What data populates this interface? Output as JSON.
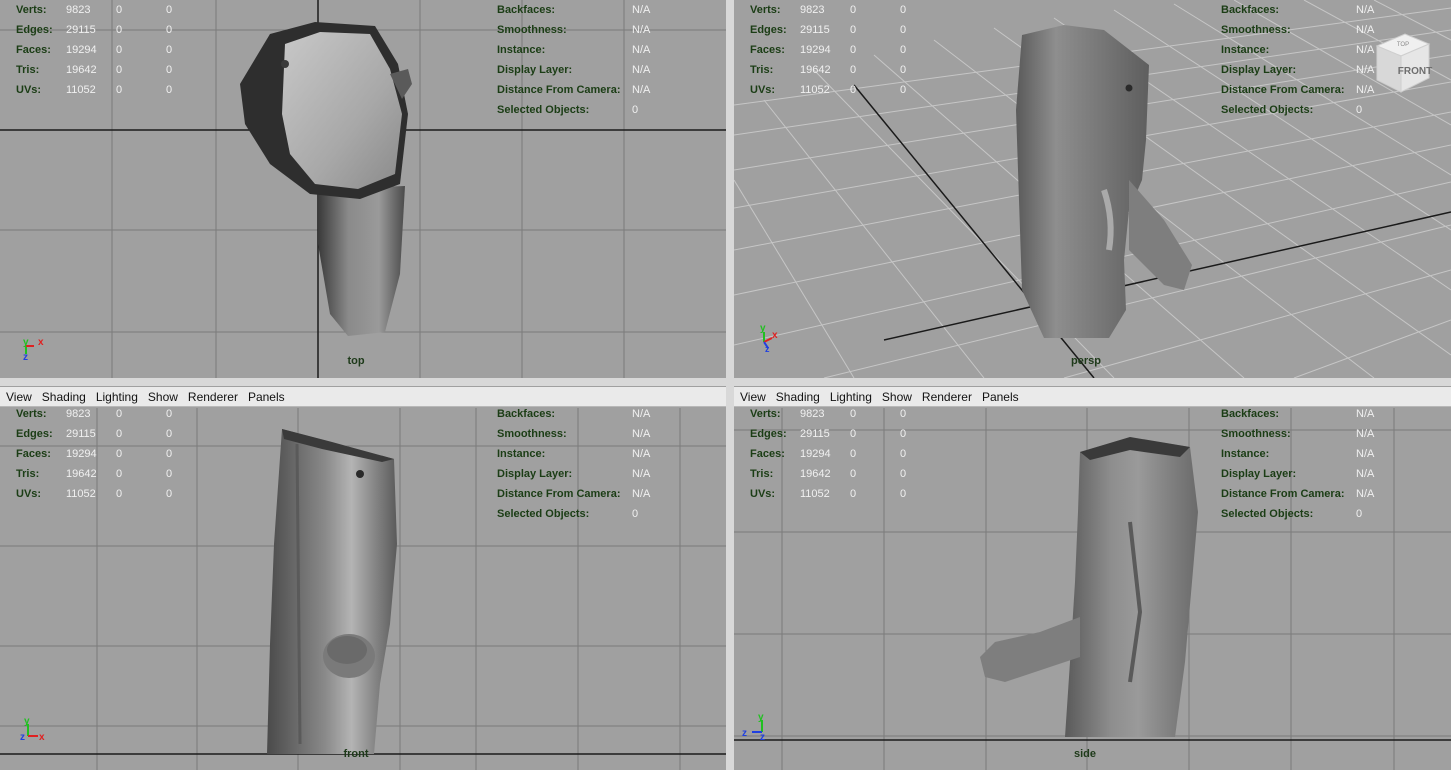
{
  "menu": [
    "View",
    "Shading",
    "Lighting",
    "Show",
    "Renderer",
    "Panels"
  ],
  "hud_left": [
    {
      "label": "Verts:",
      "values": [
        "9823",
        "0",
        "0"
      ]
    },
    {
      "label": "Edges:",
      "values": [
        "29115",
        "0",
        "0"
      ]
    },
    {
      "label": "Faces:",
      "values": [
        "19294",
        "0",
        "0"
      ]
    },
    {
      "label": "Tris:",
      "values": [
        "19642",
        "0",
        "0"
      ]
    },
    {
      "label": "UVs:",
      "values": [
        "11052",
        "0",
        "0"
      ]
    }
  ],
  "hud_right": [
    {
      "label": "Backfaces:",
      "value": "N/A"
    },
    {
      "label": "Smoothness:",
      "value": "N/A"
    },
    {
      "label": "Instance:",
      "value": "N/A"
    },
    {
      "label": "Display Layer:",
      "value": "N/A"
    },
    {
      "label": "Distance From Camera:",
      "value": "N/A"
    },
    {
      "label": "Selected Objects:",
      "value": "0"
    }
  ],
  "viewports": {
    "top": {
      "camera": "top",
      "axes": [
        "y",
        "x",
        "z"
      ]
    },
    "persp": {
      "camera": "persp",
      "axes": [
        "y",
        "x",
        "z"
      ],
      "viewcube_label": "FRONT",
      "viewcube_top": "TOP"
    },
    "front": {
      "camera": "front",
      "axes": [
        "y",
        "z",
        "x"
      ]
    },
    "side": {
      "camera": "side",
      "axes": [
        "y",
        "z",
        "z"
      ]
    }
  },
  "colors": {
    "viewport_bg": "#a0a0a0",
    "grid": "#7a7a7a",
    "origin_line": "#1a1a1a",
    "hud_label": "#1b3d15",
    "hud_value": "#f0f0f0",
    "axis_x": "#e02020",
    "axis_y": "#20c020",
    "axis_z": "#2040e0",
    "active_border": "#8aa2c8"
  }
}
